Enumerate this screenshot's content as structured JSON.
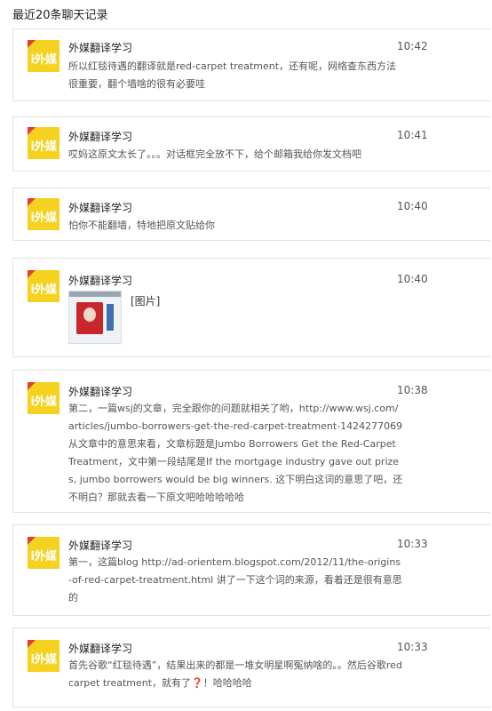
{
  "header": "最近20条聊天记录",
  "brand": {
    "avatar_color": "#f4d21f",
    "accent": "#e2402e"
  },
  "messages": [
    {
      "sender": "外媒翻译学习",
      "time": "10:42",
      "text": "所以红毯待遇的翻译就是red-carpet treatment，还有呢，网络查东西方法很重要，翻个墙啥的很有必要哇"
    },
    {
      "sender": "外媒翻译学习",
      "time": "10:41",
      "text": "哎妈这原文太长了。。。对话框完全放不下，给个邮箱我给你发文档吧"
    },
    {
      "sender": "外媒翻译学习",
      "time": "10:40",
      "text": "怕你不能翻墙，特地把原文贴给你"
    },
    {
      "sender": "外媒翻译学习",
      "time": "10:40",
      "image_label": "[图片]"
    },
    {
      "sender": "外媒翻译学习",
      "time": "10:38",
      "text": "第二，一篇wsj的文章，完全跟你的问题就相关了哟，http://www.wsj.com/articles/jumbo-borrowers-get-the-red-carpet-treatment-1424277069 从文章中的意思来看，文章标题是Jumbo Borrowers Get the Red-Carpet Treatment，文中第一段结尾是If the mortgage industry gave out prizes, jumbo borrowers would be big winners. 这下明白这词的意思了吧，还不明白？那就去看一下原文吧哈哈哈哈哈"
    },
    {
      "sender": "外媒翻译学习",
      "time": "10:33",
      "text": "第一，这篇blog http://ad-orientem.blogspot.com/2012/11/the-origins-of-red-carpet-treatment.html 讲了一下这个词的来源，看着还是很有意思的"
    },
    {
      "sender": "外媒翻译学习",
      "time": "10:33",
      "text_before": "首先谷歌“红毯待遇”，结果出来的都是一堆女明星啊冤纳啥的。。然后谷歌red carpet treatment，就有了",
      "emoji": "❓",
      "text_after": "！哈哈哈哈"
    }
  ]
}
